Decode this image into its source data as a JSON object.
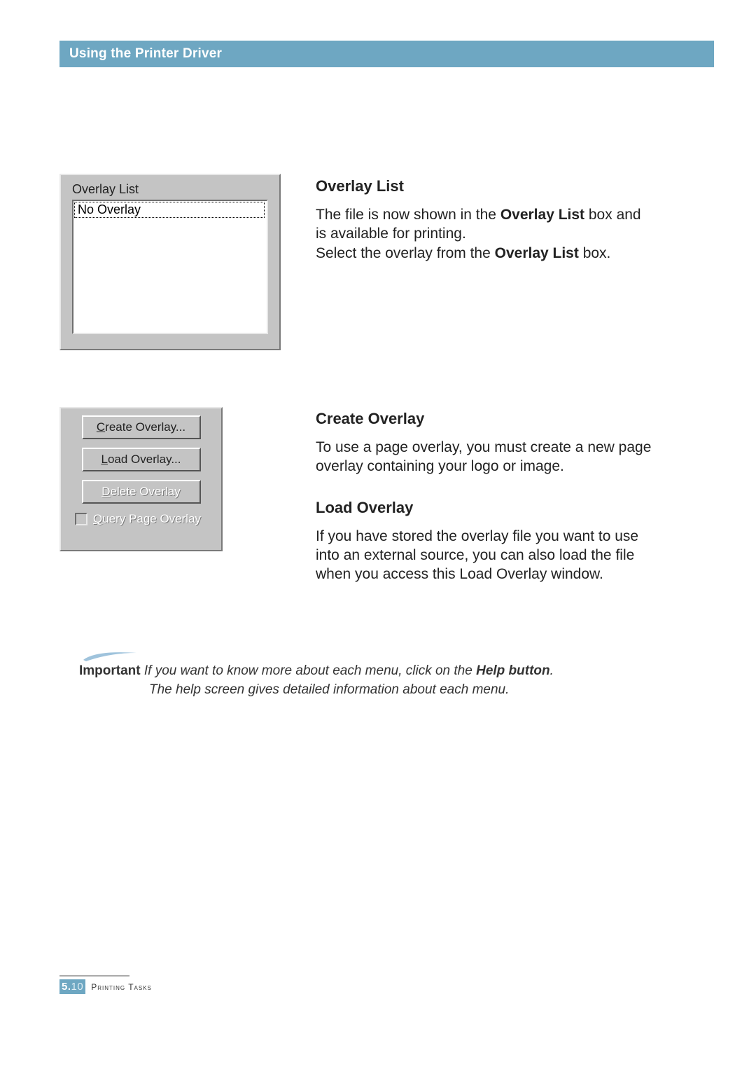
{
  "header": {
    "title": "Using the Printer Driver"
  },
  "panel1": {
    "label": "Overlay List",
    "item": "No Overlay"
  },
  "section1": {
    "heading": "Overlay List",
    "para1_a": "The file is now shown in the ",
    "para1_b": "Overlay List",
    "para1_c": " box and is available for printing.",
    "para2_a": "Select the overlay from the ",
    "para2_b": "Overlay List",
    "para2_c": " box."
  },
  "panel2": {
    "btn_create_pre": "C",
    "btn_create_post": "reate Overlay...",
    "btn_load_pre": "L",
    "btn_load_post": "oad Overlay...",
    "btn_delete_pre": "D",
    "btn_delete_post": "elete Overlay",
    "chk_pre": "Q",
    "chk_post": "uery Page Overlay"
  },
  "section2": {
    "heading_a": "Create Overlay",
    "para_a": "To use a page overlay, you must create a new page overlay containing your logo or image.",
    "heading_b": "Load Overlay",
    "para_b": "If you have stored the overlay file you want to use into an external source, you can also load the file when you access this Load Overlay window."
  },
  "note": {
    "lead": "Important",
    "line1_a": " If you want to know more about each menu, click on the ",
    "line1_b": "Help button",
    "line1_c": ".",
    "line2": "The help screen gives detailed information about each menu."
  },
  "footer": {
    "chapter": "5.",
    "page": "10",
    "label": "Printing Tasks"
  }
}
